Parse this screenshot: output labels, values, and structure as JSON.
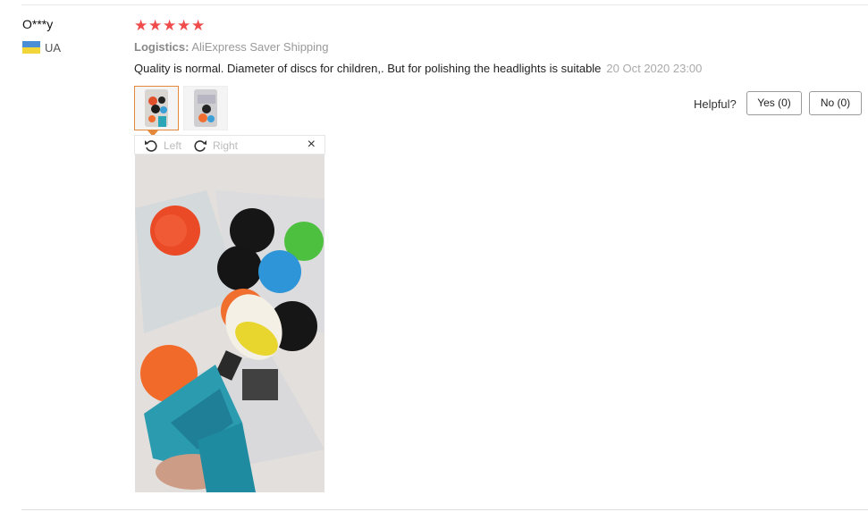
{
  "review": {
    "user_name": "O***y",
    "country": "UA",
    "rating_stars": 5,
    "star_glyphs": [
      "★",
      "★",
      "★",
      "★",
      "★"
    ],
    "logistics_label": "Logistics:",
    "logistics_value": "AliExpress Saver Shipping",
    "text": "Quality is normal. Diameter of discs for children,. But for polishing the headlights is suitable",
    "date": "20 Oct 2020 23:00"
  },
  "viewer": {
    "rotate_left_label": "Left",
    "rotate_right_label": "Right",
    "close_glyph": "×"
  },
  "feedback": {
    "helpful_label": "Helpful?",
    "yes_label": "Yes (0)",
    "no_label": "No (0)"
  },
  "colors": {
    "star": "#f04b4b",
    "active_thumb_border": "#e4893b",
    "flag_blue": "#4a8fd6",
    "flag_yellow": "#f2d538"
  },
  "icons": {
    "rotate_left": "rotate-left-icon",
    "rotate_right": "rotate-right-icon",
    "close": "close-icon",
    "flag": "ukraine-flag-icon"
  }
}
